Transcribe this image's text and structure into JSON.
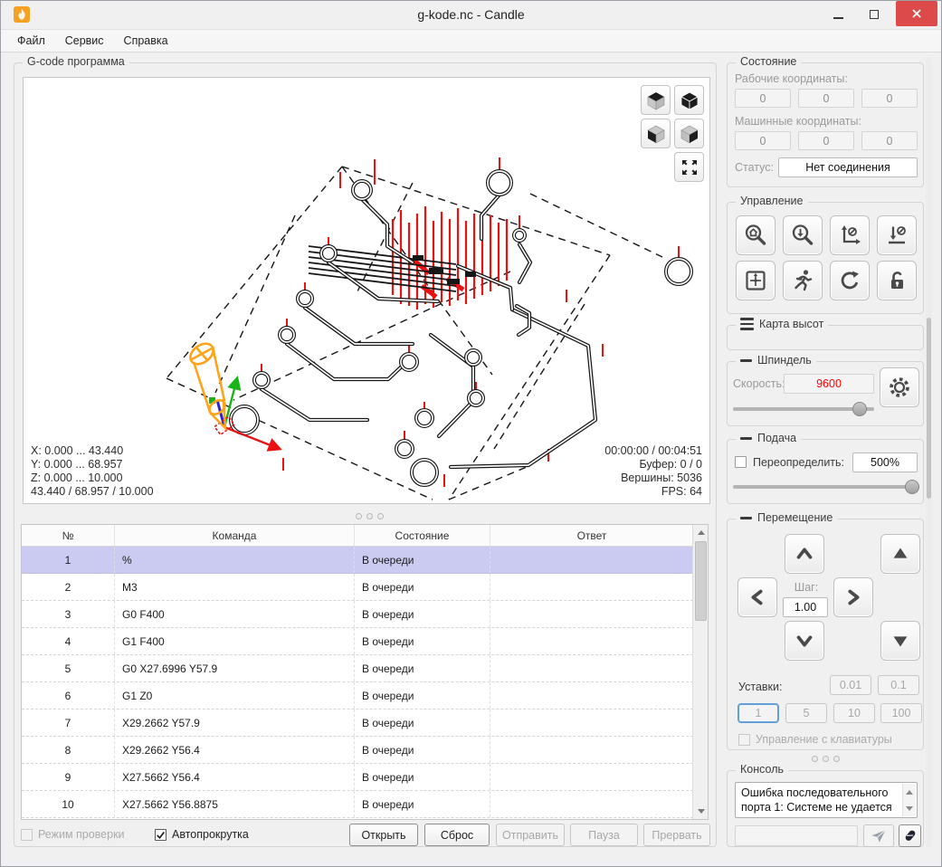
{
  "window": {
    "title": "g-kode.nc - Candle"
  },
  "menu": {
    "items": [
      "Файл",
      "Сервис",
      "Справка"
    ]
  },
  "program": {
    "group_title": "G-code программа",
    "info_left": [
      "X: 0.000 ... 43.440",
      "Y: 0.000 ... 68.957",
      "Z: 0.000 ... 10.000",
      "43.440 / 68.957 / 10.000"
    ],
    "info_right": [
      "00:00:00 / 00:04:51",
      "Буфер: 0 / 0",
      "Вершины: 5036",
      "FPS: 64"
    ]
  },
  "table": {
    "headers": [
      "№",
      "Команда",
      "Состояние",
      "Ответ"
    ],
    "rows": [
      {
        "num": "1",
        "command": "%",
        "state": "В очереди",
        "response": ""
      },
      {
        "num": "2",
        "command": "M3",
        "state": "В очереди",
        "response": ""
      },
      {
        "num": "3",
        "command": "G0 F400",
        "state": "В очереди",
        "response": ""
      },
      {
        "num": "4",
        "command": "G1 F400",
        "state": "В очереди",
        "response": ""
      },
      {
        "num": "5",
        "command": "G0 X27.6996 Y57.9",
        "state": "В очереди",
        "response": ""
      },
      {
        "num": "6",
        "command": "G1 Z0",
        "state": "В очереди",
        "response": ""
      },
      {
        "num": "7",
        "command": "X29.2662 Y57.9",
        "state": "В очереди",
        "response": ""
      },
      {
        "num": "8",
        "command": "X29.2662 Y56.4",
        "state": "В очереди",
        "response": ""
      },
      {
        "num": "9",
        "command": "X27.5662 Y56.4",
        "state": "В очереди",
        "response": ""
      },
      {
        "num": "10",
        "command": "X27.5662 Y56.8875",
        "state": "В очереди",
        "response": ""
      }
    ]
  },
  "bottom": {
    "check_mode_label": "Режим проверки",
    "autoscroll_label": "Автопрокрутка",
    "open": "Открыть",
    "reset": "Сброс",
    "send": "Отправить",
    "pause": "Пауза",
    "abort": "Прервать"
  },
  "status_panel": {
    "title": "Состояние",
    "work_label": "Рабочие координаты:",
    "machine_label": "Машинные координаты:",
    "work": [
      "0",
      "0",
      "0"
    ],
    "machine": [
      "0",
      "0",
      "0"
    ],
    "status_label": "Статус:",
    "status_value": "Нет соединения"
  },
  "control_panel": {
    "title": "Управление"
  },
  "heightmap_panel": {
    "title": "Карта высот"
  },
  "spindle_panel": {
    "title": "Шпиндель",
    "speed_label": "Скорость:",
    "speed_value": "9600"
  },
  "feed_panel": {
    "title": "Подача",
    "override_label": "Переопределить:",
    "override_value": "500%"
  },
  "jog_panel": {
    "title": "Перемещение",
    "step_label": "Шаг:",
    "step_value": "1.00",
    "presets_label": "Уставки:",
    "presets": [
      "0.01",
      "0.1",
      "1",
      "5",
      "10",
      "100"
    ],
    "active_preset": "1",
    "keyboard_label": "Управление с клавиатуры"
  },
  "console_panel": {
    "title": "Консоль",
    "log": "Ошибка последовательного порта 1: Системе не удается",
    "input_value": ""
  },
  "colors": {
    "close_button": "#dc4a4a",
    "selected_row": "#cbcbf1",
    "speed_value_text": "#ff0000",
    "active_preset_border": "#64a0d8",
    "tool": "#ffa31a",
    "rapid_moves": "#e81212"
  },
  "icons": {
    "app-flame-icon": "orange flame logo",
    "minimize-icon": "–",
    "maximize-icon": "□",
    "close-icon": "✕",
    "cube-top-icon": "cube, top face dark",
    "cube-iso-icon": "cube, all faces dark",
    "cube-left-icon": "cube, left face dark",
    "cube-right-icon": "cube, right face dark",
    "fit-view-icon": "four outward arrows",
    "home-search-icon": "magnifier with house",
    "probe-search-icon": "magnifier with down arrow",
    "zero-xy-icon": "axes with Ø",
    "zero-z-icon": "down arrow onto plane with Ø",
    "origin-icon": "crosshair in square",
    "run-icon": "running person",
    "reset-icon": "circular arrow",
    "unlock-icon": "open padlock",
    "menu-icon": "≡ hamburger",
    "collapse-icon": "— minus",
    "gear-icon": "gear / spindle",
    "send-icon": "paper plane",
    "erase-icon": "eraser",
    "check-icon": "✓"
  }
}
